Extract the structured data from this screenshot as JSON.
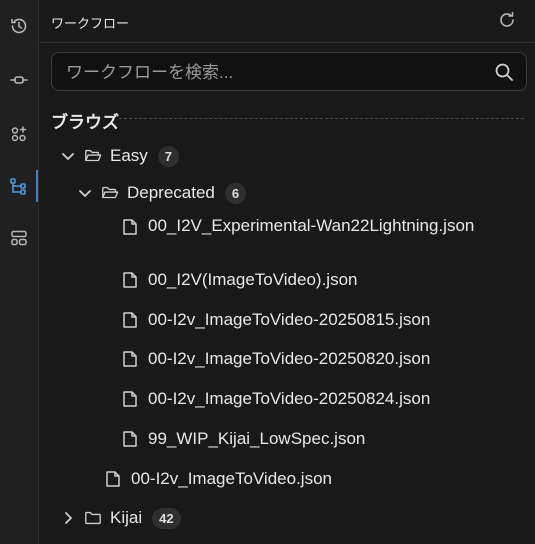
{
  "panel": {
    "title": "ワークフロー",
    "search_placeholder": "ワークフローを検索...",
    "section_label": "ブラウズ"
  },
  "rail": {
    "items": [
      {
        "icon": "history-icon",
        "active": false
      },
      {
        "icon": "node-icon",
        "active": false
      },
      {
        "icon": "models-icon",
        "active": false
      },
      {
        "icon": "workflow-icon",
        "active": true
      },
      {
        "icon": "templates-icon",
        "active": false
      }
    ]
  },
  "tree": {
    "easy": {
      "label": "Easy",
      "count": "7",
      "expanded": true
    },
    "deprecated": {
      "label": "Deprecated",
      "count": "6",
      "expanded": true
    },
    "deprecated_files": [
      "00_I2V_Experimental-Wan22Lightning.json",
      "00_I2V(ImageToVideo).json",
      "00-I2v_ImageToVideo-20250815.json",
      "00-I2v_ImageToVideo-20250820.json",
      "00-I2v_ImageToVideo-20250824.json",
      "99_WIP_Kijai_LowSpec.json"
    ],
    "easy_files": [
      "00-I2v_ImageToVideo.json"
    ],
    "kijai": {
      "label": "Kijai",
      "count": "42",
      "expanded": false
    }
  }
}
